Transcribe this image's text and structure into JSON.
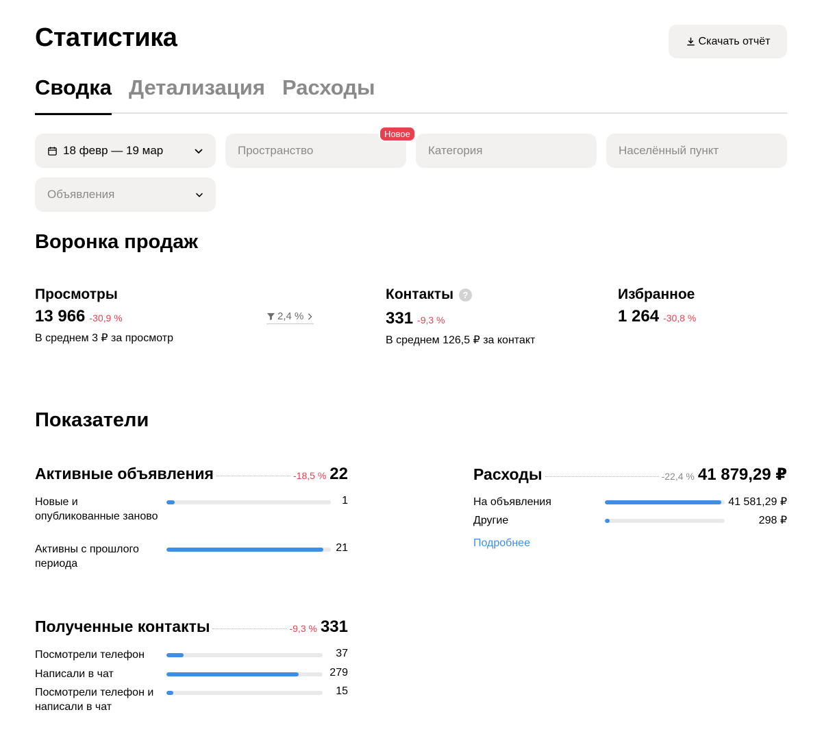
{
  "header": {
    "title": "Статистика",
    "download_label": "Скачать отчёт"
  },
  "tabs": [
    {
      "label": "Сводка",
      "active": true
    },
    {
      "label": "Детализация",
      "active": false
    },
    {
      "label": "Расходы",
      "active": false
    }
  ],
  "filters": {
    "date_range": "18 февр — 19 мар",
    "space_placeholder": "Пространство",
    "space_badge": "Новое",
    "category_placeholder": "Категория",
    "city_placeholder": "Населённый пункт",
    "ads_placeholder": "Объявления"
  },
  "funnel": {
    "title": "Воронка продаж",
    "views": {
      "label": "Просмотры",
      "value": "13 966",
      "delta": "-30,9 %",
      "sub": "В среднем 3 ₽ за просмотр"
    },
    "conversion": "2,4 %",
    "contacts": {
      "label": "Контакты",
      "value": "331",
      "delta": "-9,3 %",
      "sub": "В среднем 126,5 ₽ за контакт"
    },
    "favorites": {
      "label": "Избранное",
      "value": "1 264",
      "delta": "-30,8 %"
    }
  },
  "indicators": {
    "title": "Показатели",
    "active_ads": {
      "title": "Активные объявления",
      "delta": "-18,5 %",
      "value": "22",
      "rows": [
        {
          "label": "Новые и опубликованные заново",
          "value": "1",
          "fill": 0.05
        },
        {
          "label": "Активны с прошлого периода",
          "value": "21",
          "fill": 0.955
        }
      ]
    },
    "expenses": {
      "title": "Расходы",
      "delta": "-22,4 %",
      "value": "41 879,29 ₽",
      "rows": [
        {
          "label": "На объявления",
          "value": "41 581,29 ₽",
          "fill": 0.97
        },
        {
          "label": "Другие",
          "value": "298 ₽",
          "fill": 0.04
        }
      ],
      "more_link": "Подробнее"
    },
    "contacts": {
      "title": "Полученные контакты",
      "delta": "-9,3 %",
      "value": "331",
      "rows": [
        {
          "label": "Посмотрели телефон",
          "value": "37",
          "fill": 0.11
        },
        {
          "label": "Написали в чат",
          "value": "279",
          "fill": 0.845
        },
        {
          "label": "Посмотрели телефон и написали в чат",
          "value": "15",
          "fill": 0.045
        }
      ]
    }
  },
  "colors": {
    "accent": "#3d8ee6",
    "negative": "#e8414d",
    "muted": "#8a8a8a",
    "field_bg": "#f2f1f0"
  }
}
